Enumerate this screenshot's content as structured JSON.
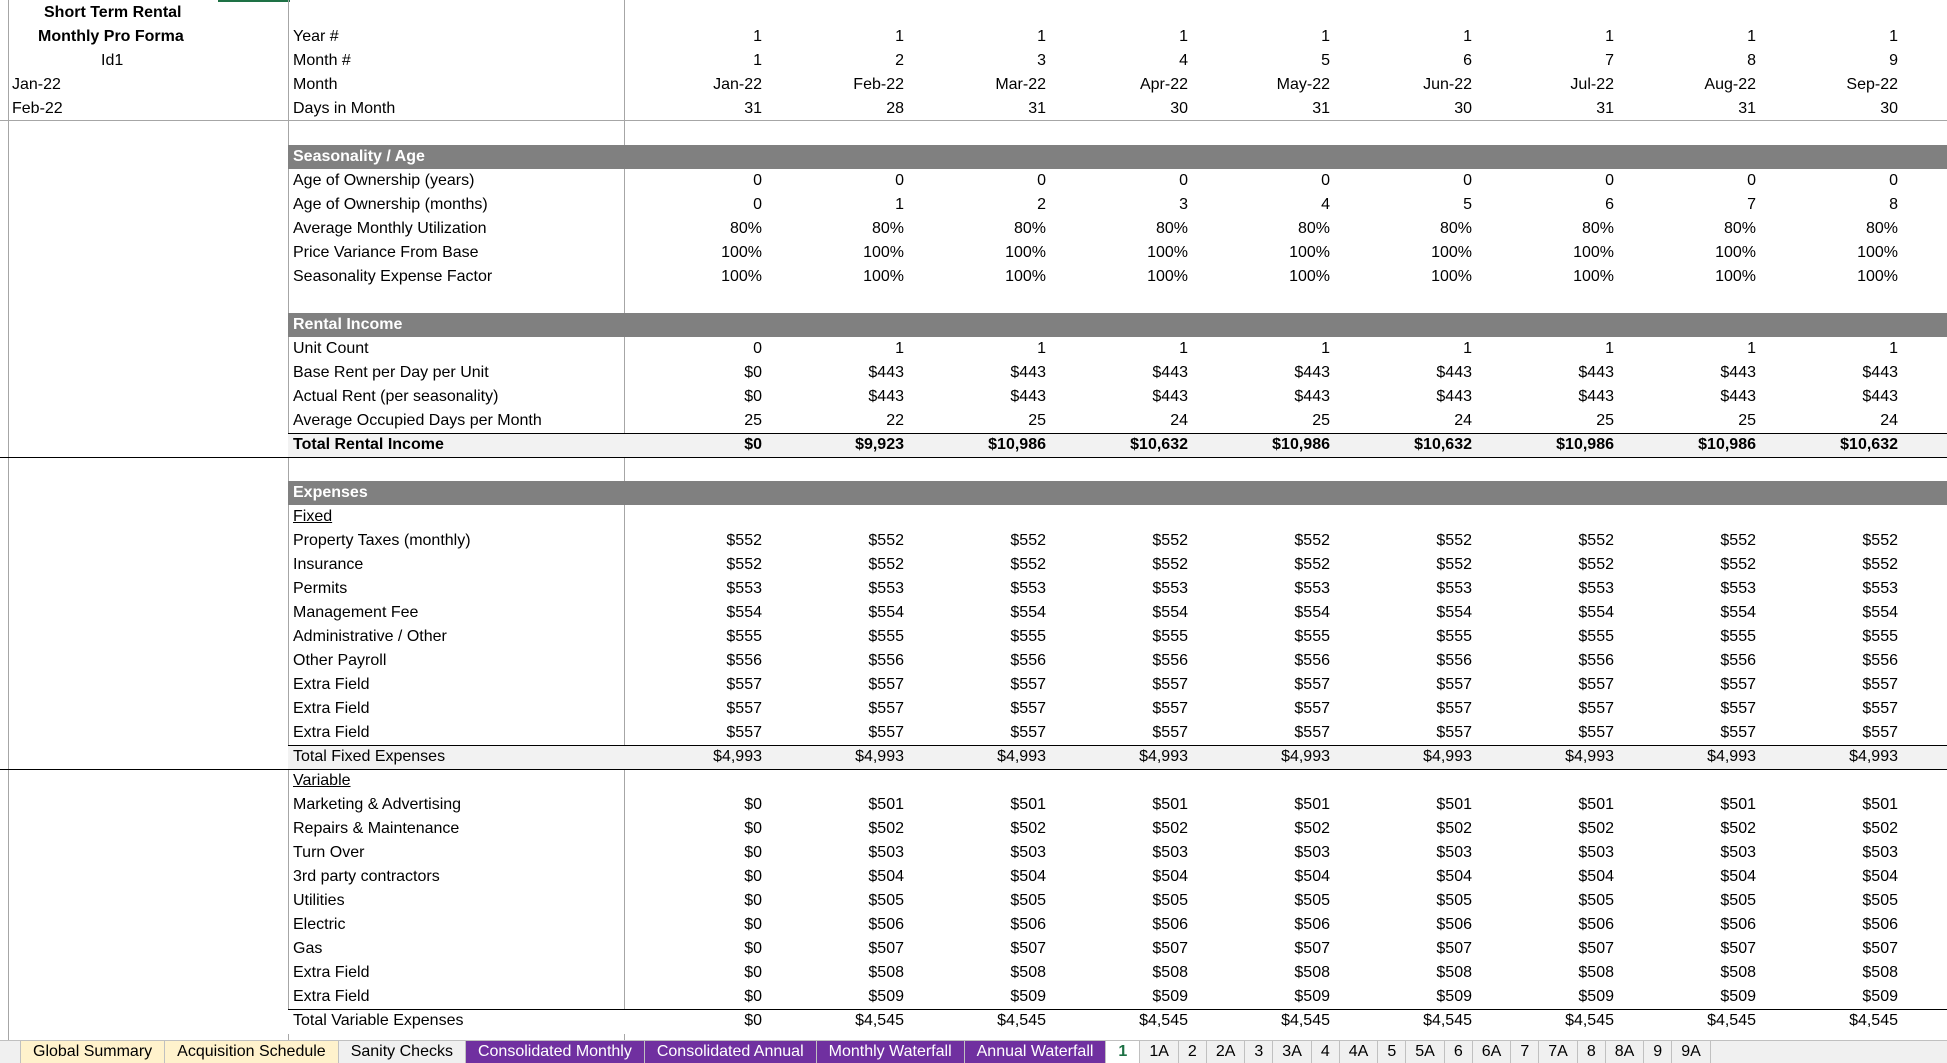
{
  "sheet": {
    "left": {
      "title1": "Short Term Rental",
      "title2": "Monthly Pro Forma",
      "id": "Id1",
      "date1": "Jan-22",
      "date2": "Feb-22"
    },
    "header_labels": [
      "Year #",
      "Month #",
      "Month",
      "Days in Month"
    ],
    "header_rows": {
      "year": [
        "1",
        "1",
        "1",
        "1",
        "1",
        "1",
        "1",
        "1",
        "1"
      ],
      "month_num": [
        "1",
        "2",
        "3",
        "4",
        "5",
        "6",
        "7",
        "8",
        "9"
      ],
      "month": [
        "Jan-22",
        "Feb-22",
        "Mar-22",
        "Apr-22",
        "May-22",
        "Jun-22",
        "Jul-22",
        "Aug-22",
        "Sep-22"
      ],
      "days": [
        "31",
        "28",
        "31",
        "30",
        "31",
        "30",
        "31",
        "31",
        "30"
      ]
    },
    "seasonality": {
      "title": "Seasonality / Age",
      "rows": [
        {
          "label": "Age of Ownership (years)",
          "values": [
            "0",
            "0",
            "0",
            "0",
            "0",
            "0",
            "0",
            "0",
            "0"
          ]
        },
        {
          "label": "Age of Ownership (months)",
          "values": [
            "0",
            "1",
            "2",
            "3",
            "4",
            "5",
            "6",
            "7",
            "8"
          ]
        },
        {
          "label": "Average Monthly Utilization",
          "values": [
            "80%",
            "80%",
            "80%",
            "80%",
            "80%",
            "80%",
            "80%",
            "80%",
            "80%"
          ]
        },
        {
          "label": "Price Variance From Base",
          "values": [
            "100%",
            "100%",
            "100%",
            "100%",
            "100%",
            "100%",
            "100%",
            "100%",
            "100%"
          ]
        },
        {
          "label": "Seasonality Expense Factor",
          "values": [
            "100%",
            "100%",
            "100%",
            "100%",
            "100%",
            "100%",
            "100%",
            "100%",
            "100%"
          ]
        }
      ]
    },
    "rental": {
      "title": "Rental Income",
      "rows": [
        {
          "label": "Unit Count",
          "values": [
            "0",
            "1",
            "1",
            "1",
            "1",
            "1",
            "1",
            "1",
            "1"
          ]
        },
        {
          "label": "Base Rent per Day per Unit",
          "values": [
            "$0",
            "$443",
            "$443",
            "$443",
            "$443",
            "$443",
            "$443",
            "$443",
            "$443"
          ]
        },
        {
          "label": "Actual Rent (per seasonality)",
          "values": [
            "$0",
            "$443",
            "$443",
            "$443",
            "$443",
            "$443",
            "$443",
            "$443",
            "$443"
          ]
        },
        {
          "label": "Average Occupied Days per Month",
          "values": [
            "25",
            "22",
            "25",
            "24",
            "25",
            "24",
            "25",
            "25",
            "24"
          ]
        }
      ],
      "total": {
        "label": "Total Rental Income",
        "values": [
          "$0",
          "$9,923",
          "$10,986",
          "$10,632",
          "$10,986",
          "$10,632",
          "$10,986",
          "$10,986",
          "$10,632"
        ]
      }
    },
    "expenses": {
      "title": "Expenses",
      "fixed_label": "Fixed",
      "fixed_rows": [
        {
          "label": "Property Taxes (monthly)",
          "values": [
            "$552",
            "$552",
            "$552",
            "$552",
            "$552",
            "$552",
            "$552",
            "$552",
            "$552"
          ]
        },
        {
          "label": "Insurance",
          "values": [
            "$552",
            "$552",
            "$552",
            "$552",
            "$552",
            "$552",
            "$552",
            "$552",
            "$552"
          ]
        },
        {
          "label": "Permits",
          "values": [
            "$553",
            "$553",
            "$553",
            "$553",
            "$553",
            "$553",
            "$553",
            "$553",
            "$553"
          ]
        },
        {
          "label": "Management Fee",
          "values": [
            "$554",
            "$554",
            "$554",
            "$554",
            "$554",
            "$554",
            "$554",
            "$554",
            "$554"
          ]
        },
        {
          "label": "Administrative / Other",
          "values": [
            "$555",
            "$555",
            "$555",
            "$555",
            "$555",
            "$555",
            "$555",
            "$555",
            "$555"
          ]
        },
        {
          "label": "Other Payroll",
          "values": [
            "$556",
            "$556",
            "$556",
            "$556",
            "$556",
            "$556",
            "$556",
            "$556",
            "$556"
          ]
        },
        {
          "label": "Extra Field",
          "values": [
            "$557",
            "$557",
            "$557",
            "$557",
            "$557",
            "$557",
            "$557",
            "$557",
            "$557"
          ]
        },
        {
          "label": "Extra Field",
          "values": [
            "$557",
            "$557",
            "$557",
            "$557",
            "$557",
            "$557",
            "$557",
            "$557",
            "$557"
          ]
        },
        {
          "label": "Extra Field",
          "values": [
            "$557",
            "$557",
            "$557",
            "$557",
            "$557",
            "$557",
            "$557",
            "$557",
            "$557"
          ]
        }
      ],
      "fixed_total": {
        "label": "Total Fixed Expenses",
        "values": [
          "$4,993",
          "$4,993",
          "$4,993",
          "$4,993",
          "$4,993",
          "$4,993",
          "$4,993",
          "$4,993",
          "$4,993"
        ]
      },
      "variable_label": "Variable",
      "variable_rows": [
        {
          "label": "Marketing & Advertising",
          "values": [
            "$0",
            "$501",
            "$501",
            "$501",
            "$501",
            "$501",
            "$501",
            "$501",
            "$501"
          ]
        },
        {
          "label": "Repairs & Maintenance",
          "values": [
            "$0",
            "$502",
            "$502",
            "$502",
            "$502",
            "$502",
            "$502",
            "$502",
            "$502"
          ]
        },
        {
          "label": "Turn Over",
          "values": [
            "$0",
            "$503",
            "$503",
            "$503",
            "$503",
            "$503",
            "$503",
            "$503",
            "$503"
          ]
        },
        {
          "label": "3rd party contractors",
          "values": [
            "$0",
            "$504",
            "$504",
            "$504",
            "$504",
            "$504",
            "$504",
            "$504",
            "$504"
          ]
        },
        {
          "label": "Utilities",
          "values": [
            "$0",
            "$505",
            "$505",
            "$505",
            "$505",
            "$505",
            "$505",
            "$505",
            "$505"
          ]
        },
        {
          "label": "Electric",
          "values": [
            "$0",
            "$506",
            "$506",
            "$506",
            "$506",
            "$506",
            "$506",
            "$506",
            "$506"
          ]
        },
        {
          "label": "Gas",
          "values": [
            "$0",
            "$507",
            "$507",
            "$507",
            "$507",
            "$507",
            "$507",
            "$507",
            "$507"
          ]
        },
        {
          "label": "Extra Field",
          "values": [
            "$0",
            "$508",
            "$508",
            "$508",
            "$508",
            "$508",
            "$508",
            "$508",
            "$508"
          ]
        },
        {
          "label": "Extra Field",
          "values": [
            "$0",
            "$509",
            "$509",
            "$509",
            "$509",
            "$509",
            "$509",
            "$509",
            "$509"
          ]
        }
      ],
      "variable_total": {
        "label": "Total Variable Expenses",
        "values": [
          "$0",
          "$4,545",
          "$4,545",
          "$4,545",
          "$4,545",
          "$4,545",
          "$4,545",
          "$4,545",
          "$4,545"
        ]
      }
    }
  },
  "tabs": [
    {
      "label": "Global Summary",
      "style": "yellow"
    },
    {
      "label": "Acquisition Schedule",
      "style": "yellow"
    },
    {
      "label": "Sanity Checks",
      "style": "plain"
    },
    {
      "label": "Consolidated Monthly",
      "style": "purple"
    },
    {
      "label": "Consolidated Annual",
      "style": "purple"
    },
    {
      "label": "Monthly Waterfall",
      "style": "purple"
    },
    {
      "label": "Annual Waterfall",
      "style": "purple"
    },
    {
      "label": "1",
      "style": "active"
    },
    {
      "label": "1A",
      "style": "num"
    },
    {
      "label": "2",
      "style": "num"
    },
    {
      "label": "2A",
      "style": "num"
    },
    {
      "label": "3",
      "style": "num"
    },
    {
      "label": "3A",
      "style": "num"
    },
    {
      "label": "4",
      "style": "num"
    },
    {
      "label": "4A",
      "style": "num"
    },
    {
      "label": "5",
      "style": "num"
    },
    {
      "label": "5A",
      "style": "num"
    },
    {
      "label": "6",
      "style": "num"
    },
    {
      "label": "6A",
      "style": "num"
    },
    {
      "label": "7",
      "style": "num"
    },
    {
      "label": "7A",
      "style": "num"
    },
    {
      "label": "8",
      "style": "num"
    },
    {
      "label": "8A",
      "style": "num"
    },
    {
      "label": "9",
      "style": "num"
    },
    {
      "label": "9A",
      "style": "num"
    }
  ]
}
